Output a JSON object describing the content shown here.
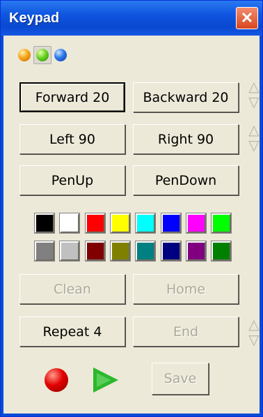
{
  "window": {
    "title": "Keypad",
    "close_symbol": "✕"
  },
  "colors": {
    "titlebar": "#0f55e0",
    "client_bg": "#ece9d8",
    "disabled_text": "#aca899"
  },
  "pen_indicators": [
    "orange-ball-icon",
    "green-ball-icon",
    "blue-ball-icon"
  ],
  "buttons": {
    "forward": "Forward 20",
    "backward": "Backward 20",
    "left": "Left 90",
    "right": "Right 90",
    "penup": "PenUp",
    "pendown": "PenDown",
    "clean": "Clean",
    "home": "Home",
    "repeat": "Repeat 4",
    "end": "End",
    "save": "Save"
  },
  "spinners": {
    "up": "△",
    "down": "▽"
  },
  "palette": [
    "#000000",
    "#ffffff",
    "#ff0000",
    "#ffff00",
    "#00ffff",
    "#0000ff",
    "#ff00ff",
    "#00ff00",
    "#808080",
    "#c0c0c0",
    "#800000",
    "#808000",
    "#008080",
    "#000080",
    "#800080",
    "#008000"
  ],
  "media_icons": [
    "record-icon",
    "play-icon"
  ]
}
